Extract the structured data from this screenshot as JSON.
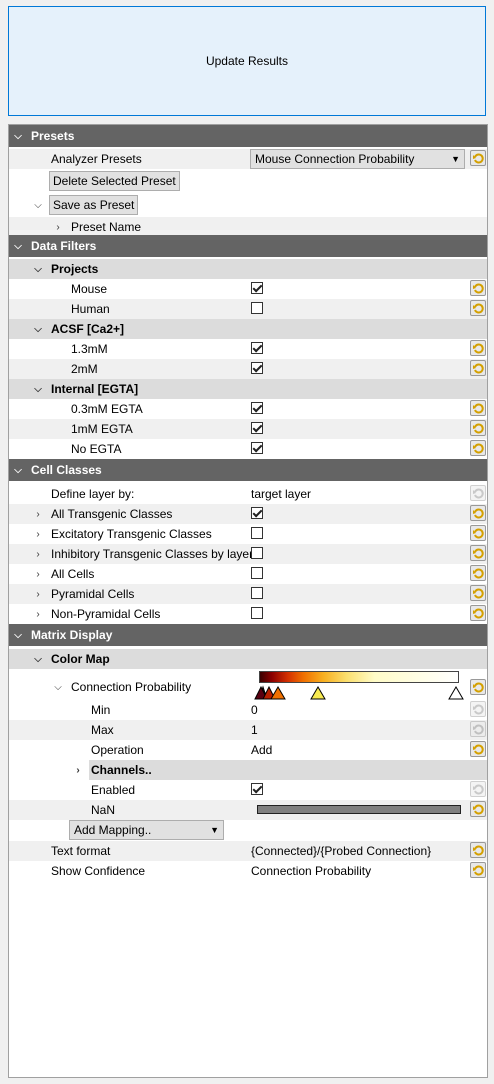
{
  "update_button": "Update Results",
  "presets": {
    "header": "Presets",
    "analyzer_presets_label": "Analyzer Presets",
    "analyzer_presets_value": "Mouse Connection Probability",
    "delete_button": "Delete Selected Preset",
    "save_button": "Save as Preset",
    "preset_name_label": "Preset Name"
  },
  "data_filters": {
    "header": "Data Filters",
    "projects": {
      "label": "Projects",
      "items": [
        {
          "label": "Mouse",
          "checked": true
        },
        {
          "label": "Human",
          "checked": false
        }
      ]
    },
    "acsf": {
      "label": "ACSF [Ca2+]",
      "items": [
        {
          "label": "1.3mM",
          "checked": true
        },
        {
          "label": "2mM",
          "checked": true
        }
      ]
    },
    "internal": {
      "label": "Internal [EGTA]",
      "items": [
        {
          "label": "0.3mM EGTA",
          "checked": true
        },
        {
          "label": "1mM EGTA",
          "checked": true
        },
        {
          "label": "No EGTA",
          "checked": true
        }
      ]
    }
  },
  "cell_classes": {
    "header": "Cell Classes",
    "define_layer_label": "Define layer by:",
    "define_layer_value": "target layer",
    "items": [
      {
        "label": "All Transgenic Classes",
        "checked": true
      },
      {
        "label": "Excitatory Transgenic Classes",
        "checked": false
      },
      {
        "label": "Inhibitory Transgenic Classes by layer",
        "checked": false
      },
      {
        "label": "All Cells",
        "checked": false
      },
      {
        "label": "Pyramidal Cells",
        "checked": false
      },
      {
        "label": "Non-Pyramidal Cells",
        "checked": false
      }
    ]
  },
  "matrix_display": {
    "header": "Matrix Display",
    "color_map_label": "Color Map",
    "connection_probability_label": "Connection Probability",
    "min_label": "Min",
    "min_value": "0",
    "max_label": "Max",
    "max_value": "1",
    "operation_label": "Operation",
    "operation_value": "Add",
    "channels_label": "Channels..",
    "enabled_label": "Enabled",
    "enabled_checked": true,
    "nan_label": "NaN",
    "nan_color": "#808080",
    "add_mapping_label": "Add Mapping..",
    "text_format_label": "Text format",
    "text_format_value": "{Connected}/{Probed Connection}",
    "show_confidence_label": "Show Confidence",
    "show_confidence_value": "Connection Probability"
  },
  "colors": {
    "header_bg": "#646464",
    "subheader_bg": "#dcdcdc",
    "button_bg": "#e5f1fb",
    "button_border": "#0078d7"
  }
}
